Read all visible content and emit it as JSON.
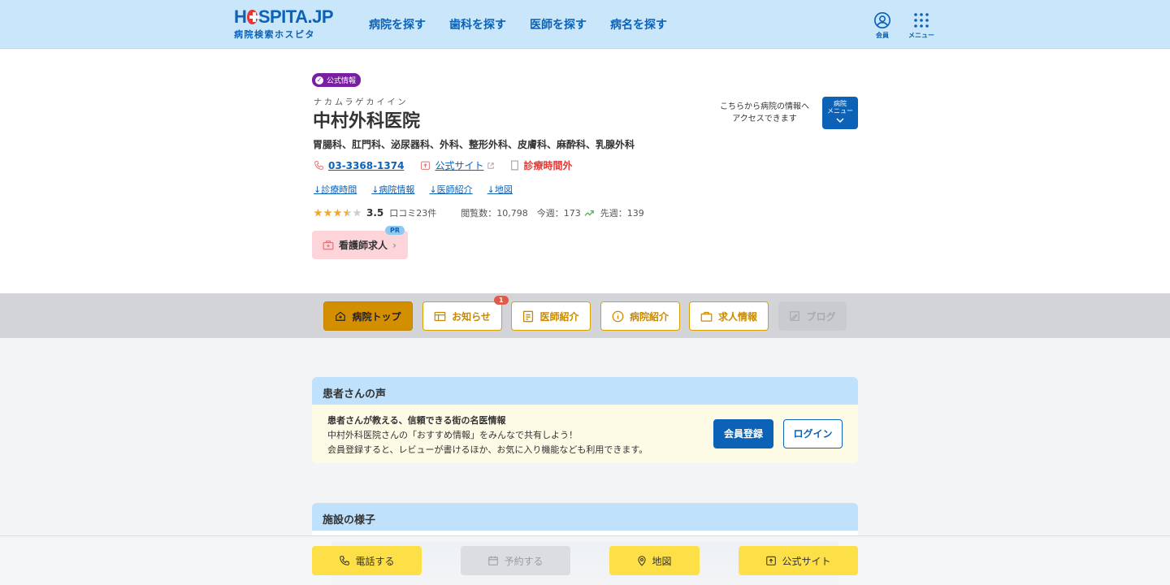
{
  "header": {
    "logo_main_pre": "H",
    "logo_main_post": "SPITA.JP",
    "logo_sub": "病院検索ホスピタ",
    "nav": [
      "病院を探す",
      "歯科を探す",
      "医師を探す",
      "病名を探す"
    ],
    "member_label": "会員",
    "menu_label": "メニュー"
  },
  "hospital": {
    "official_badge": "公式情報",
    "kana": "ナカムラゲカイイン",
    "name": "中村外科医院",
    "departments": "胃腸科、肛門科、泌尿器科、外科、整形外科、皮膚科、麻酔科、乳腺外科",
    "phone": "03-3368-1374",
    "site_label": "公式サイト",
    "status": "診療時間外",
    "anchors": [
      "↓診療時間",
      "↓病院情報",
      "↓医師紹介",
      "↓地図"
    ],
    "rating": 3.5,
    "rating_text": "3.5",
    "reviews": "口コミ23件",
    "views": "閲覧数：10,798　今週：173",
    "last_week": "先週：139",
    "nurse_label": "看護師求人",
    "pr": "PR",
    "menu_hint_line1": "こちらから病院の情報へ",
    "menu_hint_line2": "アクセスできます",
    "menu_btn_line1": "病院",
    "menu_btn_line2": "メニュー"
  },
  "tabs": [
    {
      "label": "病院トップ",
      "icon": "hospital-icon",
      "state": "active"
    },
    {
      "label": "お知らせ",
      "icon": "news-icon",
      "state": "normal",
      "badge": "1"
    },
    {
      "label": "医師紹介",
      "icon": "doctor-icon",
      "state": "normal"
    },
    {
      "label": "病院紹介",
      "icon": "info-icon",
      "state": "normal"
    },
    {
      "label": "求人情報",
      "icon": "briefcase-icon",
      "state": "normal"
    },
    {
      "label": "ブログ",
      "icon": "blog-icon",
      "state": "disabled"
    }
  ],
  "voice": {
    "title": "患者さんの声",
    "line1": "患者さんが教える、信頼できる街の名医情報",
    "line2": "中村外科医院さんの「おすすめ情報」をみんなで共有しよう！",
    "line3": "会員登録すると、レビューが書けるほか、お気に入り機能なども利用できます。",
    "register": "会員登録",
    "login": "ログイン"
  },
  "facility": {
    "title": "施設の様子"
  },
  "bottom": {
    "call": "電話する",
    "reserve": "予約する",
    "map": "地図",
    "site": "公式サイト"
  },
  "colors": {
    "primary": "#0c62b7",
    "header_bg": "#c9e6fb",
    "accent_yellow": "#fde047",
    "tab_active": "#d48f00",
    "official_purple": "#7b1fa2",
    "closed_red": "#e53935"
  }
}
